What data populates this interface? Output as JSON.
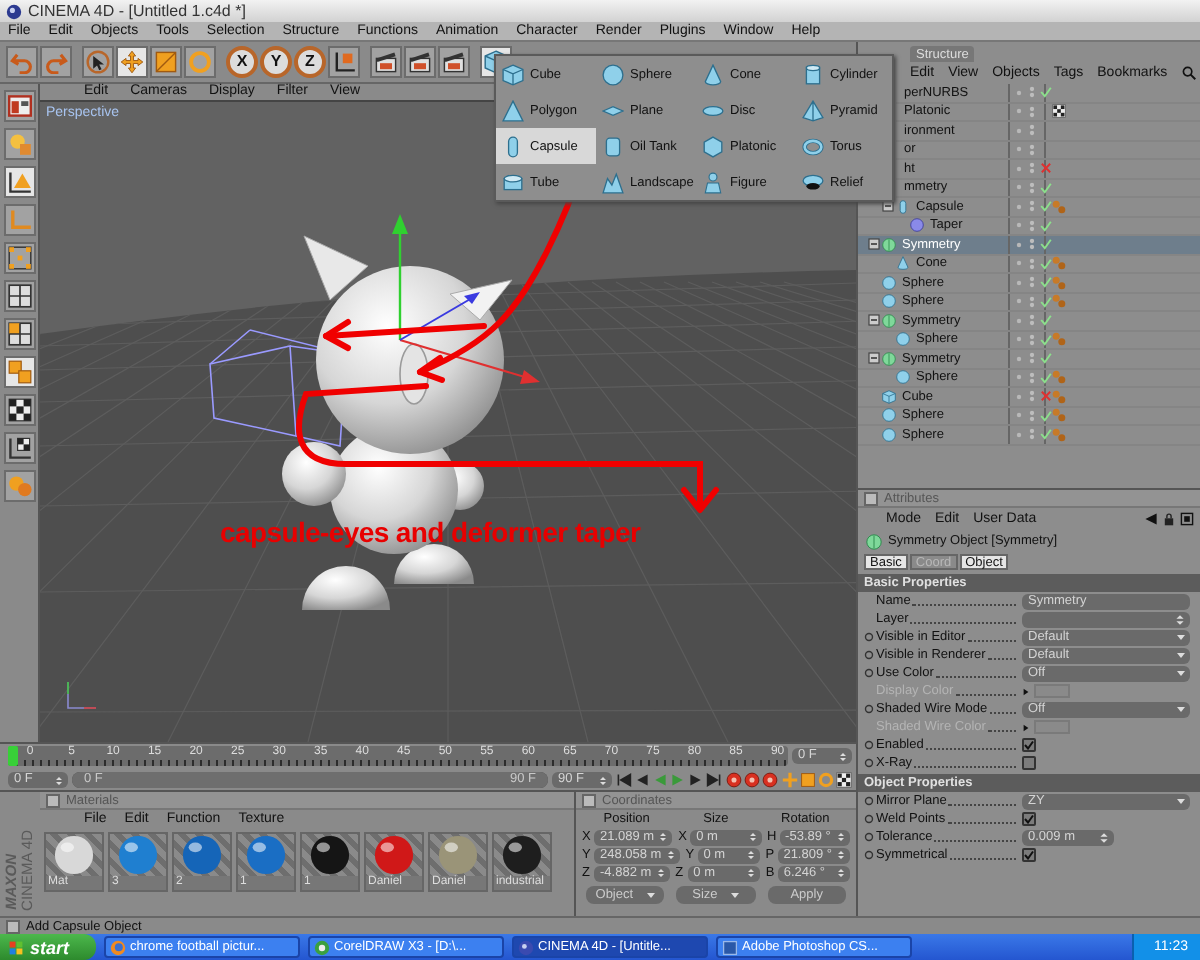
{
  "window": {
    "title": "CINEMA 4D - [Untitled 1.c4d *]"
  },
  "menu": [
    "File",
    "Edit",
    "Objects",
    "Tools",
    "Selection",
    "Structure",
    "Functions",
    "Animation",
    "Character",
    "Render",
    "Plugins",
    "Window",
    "Help"
  ],
  "toolbar": [
    {
      "kind": "undo",
      "selected": false
    },
    {
      "kind": "redo",
      "selected": false
    },
    {
      "kind": "separator"
    },
    {
      "kind": "pointer",
      "selected": false
    },
    {
      "kind": "move",
      "selected": true
    },
    {
      "kind": "scale",
      "selected": false
    },
    {
      "kind": "rotate",
      "selected": false
    },
    {
      "kind": "separator"
    },
    {
      "kind": "axis",
      "label": "X",
      "selected": false
    },
    {
      "kind": "axis",
      "label": "Y",
      "selected": false
    },
    {
      "kind": "axis",
      "label": "Z",
      "selected": false
    },
    {
      "kind": "coords",
      "selected": false
    },
    {
      "kind": "separator"
    },
    {
      "kind": "render",
      "selected": false
    },
    {
      "kind": "render",
      "selected": false
    },
    {
      "kind": "render",
      "selected": false
    },
    {
      "kind": "separator"
    },
    {
      "kind": "cube",
      "selected": true
    }
  ],
  "left_tools": [
    {
      "kind": "layout",
      "selected": false
    },
    {
      "kind": "lights",
      "selected": false
    },
    {
      "kind": "model",
      "selected": true
    },
    {
      "kind": "axis",
      "selected": false
    },
    {
      "kind": "points",
      "selected": false
    },
    {
      "kind": "edges",
      "selected": false
    },
    {
      "kind": "polygons",
      "selected": false
    },
    {
      "kind": "objects",
      "selected": true
    },
    {
      "kind": "texture",
      "selected": false
    },
    {
      "kind": "texture-axis",
      "selected": false
    },
    {
      "kind": "sculpt",
      "selected": false
    }
  ],
  "viewport": {
    "menu": [
      "Edit",
      "Cameras",
      "Display",
      "Filter",
      "View"
    ],
    "camera": "Perspective",
    "annotation": "capsule-eyes and deformer taper"
  },
  "object_menu": {
    "items": [
      {
        "kind": "cube",
        "label": "Cube",
        "selected": false
      },
      {
        "kind": "polygon",
        "label": "Polygon",
        "selected": false
      },
      {
        "kind": "capsule",
        "label": "Capsule",
        "selected": true
      },
      {
        "kind": "tube",
        "label": "Tube",
        "selected": false
      },
      {
        "kind": "sphere",
        "label": "Sphere",
        "selected": false
      },
      {
        "kind": "plane",
        "label": "Plane",
        "selected": false
      },
      {
        "kind": "oiltank",
        "label": "Oil Tank",
        "selected": false
      },
      {
        "kind": "landscape",
        "label": "Landscape",
        "selected": false
      },
      {
        "kind": "cone",
        "label": "Cone",
        "selected": false
      },
      {
        "kind": "disc",
        "label": "Disc",
        "selected": false
      },
      {
        "kind": "platonic",
        "label": "Platonic",
        "selected": false
      },
      {
        "kind": "figure",
        "label": "Figure",
        "selected": false
      },
      {
        "kind": "cylinder",
        "label": "Cylinder",
        "selected": false
      },
      {
        "kind": "pyramid",
        "label": "Pyramid",
        "selected": false
      },
      {
        "kind": "torus",
        "label": "Torus",
        "selected": false
      },
      {
        "kind": "relief",
        "label": "Relief",
        "selected": false
      }
    ]
  },
  "object_manager": {
    "tabs": [
      {
        "label": "Structure"
      }
    ],
    "menu": [
      "Edit",
      "View",
      "Objects",
      "Tags",
      "Bookmarks"
    ],
    "objects": [
      {
        "name": "perNURBS",
        "selected": false,
        "enabled": true
      },
      {
        "name": "Platonic",
        "selected": false,
        "tags": [
          {
            "kind": "checker"
          }
        ]
      },
      {
        "name": "ironment",
        "selected": false
      },
      {
        "name": "or",
        "selected": false
      },
      {
        "name": "ht",
        "selected": false,
        "enabled": false
      },
      {
        "name": "mmetry",
        "selected": false,
        "enabled": true,
        "children": [
          {
            "kind": "capsule",
            "name": "Capsule",
            "selected": false,
            "enabled": true,
            "tags": [
              {
                "kind": "material"
              }
            ],
            "expanded": true,
            "children": [
              {
                "kind": "taper",
                "name": "Taper",
                "selected": false,
                "enabled": true
              }
            ]
          }
        ]
      },
      {
        "kind": "symmetry",
        "name": "Symmetry",
        "selected": true,
        "enabled": true,
        "expanded": true,
        "children": [
          {
            "kind": "cone",
            "name": "Cone",
            "selected": false,
            "enabled": true,
            "tags": [
              {
                "kind": "material"
              }
            ]
          }
        ]
      },
      {
        "kind": "sphere",
        "name": "Sphere",
        "selected": false,
        "enabled": true,
        "tags": [
          {
            "kind": "material"
          }
        ]
      },
      {
        "kind": "sphere",
        "name": "Sphere",
        "selected": false,
        "enabled": true,
        "tags": [
          {
            "kind": "material"
          }
        ]
      },
      {
        "kind": "symmetry",
        "name": "Symmetry",
        "selected": false,
        "enabled": true,
        "expanded": true,
        "children": [
          {
            "kind": "sphere",
            "name": "Sphere",
            "selected": false,
            "enabled": true,
            "tags": [
              {
                "kind": "material"
              }
            ]
          }
        ]
      },
      {
        "kind": "symmetry",
        "name": "Symmetry",
        "selected": false,
        "enabled": true,
        "expanded": true,
        "children": [
          {
            "kind": "sphere",
            "name": "Sphere",
            "selected": false,
            "enabled": true,
            "tags": [
              {
                "kind": "material"
              }
            ]
          }
        ]
      },
      {
        "kind": "cube",
        "name": "Cube",
        "selected": false,
        "enabled": false,
        "tags": [
          {
            "kind": "material"
          }
        ]
      },
      {
        "kind": "sphere",
        "name": "Sphere",
        "selected": false,
        "enabled": true,
        "tags": [
          {
            "kind": "material"
          }
        ]
      },
      {
        "kind": "sphere",
        "name": "Sphere",
        "selected": false,
        "enabled": true,
        "tags": [
          {
            "kind": "material"
          }
        ]
      }
    ]
  },
  "attributes": {
    "title": "Attributes",
    "menu": [
      "Mode",
      "Edit",
      "User Data"
    ],
    "object": "Symmetry Object [Symmetry]",
    "tabs": [
      {
        "label": "Basic",
        "selected": true
      },
      {
        "label": "Coord",
        "selected": false
      },
      {
        "label": "Object",
        "selected": true
      }
    ],
    "sections": [
      {
        "title": "Basic Properties",
        "properties": [
          {
            "kind": "text",
            "label": "Name",
            "value": "Symmetry",
            "animatable": false,
            "disabled": false
          },
          {
            "kind": "layer",
            "label": "Layer",
            "animatable": false,
            "disabled": false
          },
          {
            "kind": "dropdown",
            "label": "Visible in Editor",
            "value": "Default",
            "animatable": true,
            "disabled": false
          },
          {
            "kind": "dropdown",
            "label": "Visible in Renderer",
            "value": "Default",
            "animatable": true,
            "disabled": false
          },
          {
            "kind": "dropdown",
            "label": "Use Color",
            "value": "Off",
            "animatable": true,
            "disabled": false
          },
          {
            "kind": "color",
            "label": "Display Color",
            "animatable": false,
            "disabled": true
          },
          {
            "kind": "dropdown",
            "label": "Shaded Wire Mode",
            "value": "Off",
            "animatable": true,
            "disabled": false
          },
          {
            "kind": "color",
            "label": "Shaded Wire Color",
            "animatable": false,
            "disabled": true
          },
          {
            "kind": "checkbox",
            "label": "Enabled",
            "checked": true,
            "animatable": true,
            "disabled": false
          },
          {
            "kind": "checkbox",
            "label": "X-Ray",
            "checked": false,
            "animatable": true,
            "disabled": false
          }
        ]
      },
      {
        "title": "Object Properties",
        "properties": [
          {
            "kind": "dropdown",
            "label": "Mirror Plane",
            "value": "ZY",
            "animatable": true,
            "disabled": false
          },
          {
            "kind": "checkbox",
            "label": "Weld Points",
            "checked": true,
            "animatable": true,
            "disabled": false
          },
          {
            "kind": "number",
            "label": "Tolerance",
            "value": "0.009 m",
            "animatable": true,
            "disabled": false
          },
          {
            "kind": "checkbox",
            "label": "Symmetrical",
            "checked": true,
            "animatable": true,
            "disabled": false
          }
        ]
      }
    ]
  },
  "timeline": {
    "ticks": [
      "0",
      "5",
      "10",
      "15",
      "20",
      "25",
      "30",
      "35",
      "40",
      "45",
      "50",
      "55",
      "60",
      "65",
      "70",
      "75",
      "80",
      "85",
      "90"
    ],
    "level": 0,
    "frame": "0 F",
    "start": "0 F",
    "range": {
      "start": "0 F",
      "end": "90 F",
      "level": 1
    },
    "end": "90 F"
  },
  "materials": {
    "title": "Materials",
    "menu": [
      "File",
      "Edit",
      "Function",
      "Texture"
    ],
    "items": [
      {
        "name": "Mat",
        "color": "#d8d8d8"
      },
      {
        "name": "3",
        "color": "#1f7fd0"
      },
      {
        "name": "2",
        "color": "#1565b8"
      },
      {
        "name": "1",
        "color": "#1a6ec4"
      },
      {
        "name": "1",
        "color": "#151515"
      },
      {
        "name": "Daniel",
        "color": "#d01818"
      },
      {
        "name": "Daniel",
        "color": "#9a9478"
      },
      {
        "name": "industrial",
        "color": "#1e1e1e"
      }
    ]
  },
  "coordinates": {
    "title": "Coordinates",
    "columns": [
      "Position",
      "Size",
      "Rotation"
    ],
    "rows": [
      [
        {
          "axis": "X",
          "value": "21.089 m"
        },
        {
          "axis": "X",
          "value": "0 m"
        },
        {
          "axis": "H",
          "value": "-53.89 °"
        }
      ],
      [
        {
          "axis": "Y",
          "value": "248.058 m"
        },
        {
          "axis": "Y",
          "value": "0 m"
        },
        {
          "axis": "P",
          "value": "21.809 °"
        }
      ],
      [
        {
          "axis": "Z",
          "value": "-4.882 m"
        },
        {
          "axis": "Z",
          "value": "0 m"
        },
        {
          "axis": "B",
          "value": "6.246 °"
        }
      ]
    ],
    "modes": [
      "Object",
      "Size"
    ],
    "apply": "Apply"
  },
  "branding": [
    "MAXON",
    "CINEMA 4D"
  ],
  "status": "Add Capsule Object",
  "taskbar": {
    "start": "start",
    "tasks": [
      {
        "kind": "browser",
        "label": "chrome football pictur...",
        "selected": false
      },
      {
        "kind": "graphics",
        "label": "CorelDRAW X3 - [D:\\...",
        "selected": false
      },
      {
        "kind": "modeler",
        "label": "CINEMA 4D - [Untitle...",
        "selected": true
      },
      {
        "kind": "photo",
        "label": "Adobe Photoshop CS...",
        "selected": false
      }
    ],
    "clock": "11:23"
  }
}
